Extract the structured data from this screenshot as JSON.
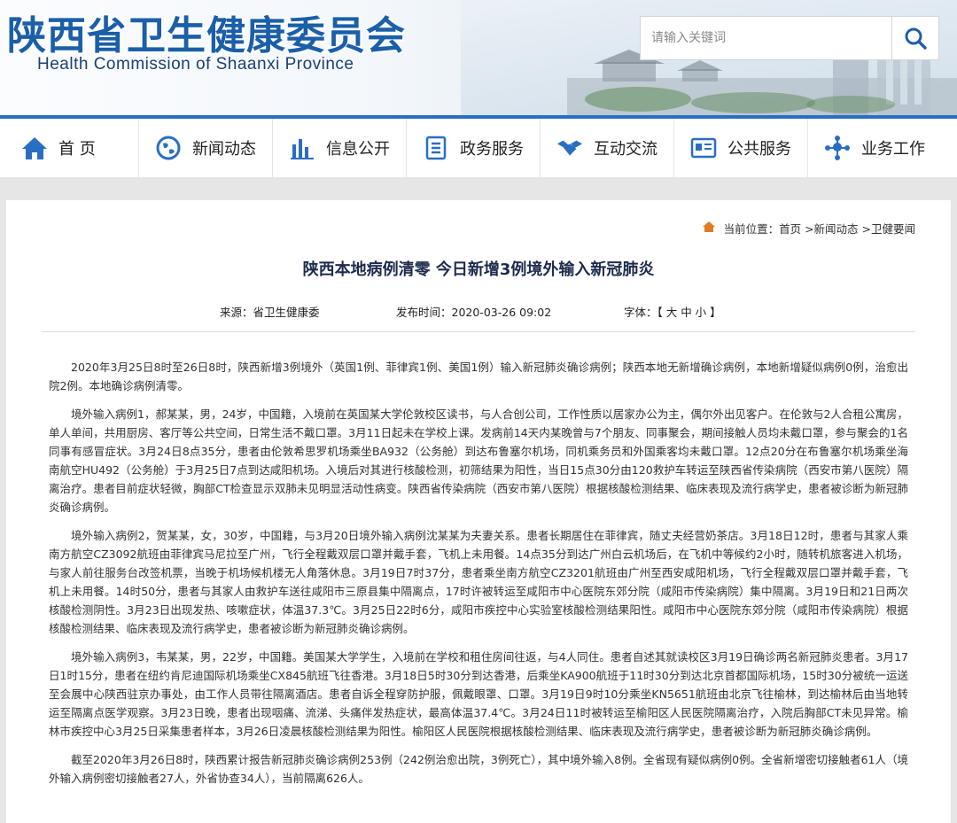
{
  "header": {
    "title": "陕西省卫生健康委员会",
    "subtitle": "Health Commission of Shaanxi Province",
    "search_placeholder": "请输入关键词"
  },
  "nav": {
    "items": [
      {
        "label": "首 页",
        "icon": "home-icon"
      },
      {
        "label": "新闻动态",
        "icon": "globe-icon"
      },
      {
        "label": "信息公开",
        "icon": "bar-chart-icon"
      },
      {
        "label": "政务服务",
        "icon": "document-icon"
      },
      {
        "label": "互动交流",
        "icon": "handshake-icon"
      },
      {
        "label": "公共服务",
        "icon": "id-card-icon"
      },
      {
        "label": "业务工作",
        "icon": "network-icon"
      }
    ]
  },
  "breadcrumb": {
    "prefix": "当前位置：",
    "path": "首页 >新闻动态 >卫健要闻"
  },
  "article": {
    "title": "陕西本地病例清零 今日新增3例境外输入新冠肺炎",
    "source": "来源：省卫生健康委",
    "publish_time": "发布时间：2020-03-26 09:02",
    "font_size": "字体：【 大 中 小 】",
    "paragraphs": [
      "2020年3月25日8时至26日8时，陕西新增3例境外（英国1例、菲律宾1例、美国1例）输入新冠肺炎确诊病例；陕西本地无新增确诊病例，本地新增疑似病例0例，治愈出院2例。本地确诊病例清零。",
      "境外输入病例1，郝某某，男，24岁，中国籍，入境前在英国某大学伦敦校区读书，与人合创公司，工作性质以居家办公为主，偶尔外出见客户。在伦敦与2人合租公寓房，单人单间，共用厨房、客厅等公共空间，日常生活不戴口罩。3月11日起未在学校上课。发病前14天内某晚曾与7个朋友、同事聚会，期间接触人员均未戴口罩，参与聚会的1名同事有感冒症状。3月24日8点35分，患者由伦敦希思罗机场乘坐BA932（公务舱）到达布鲁塞尔机场，同机乘务员和外国乘客均未戴口罩。12点20分在布鲁塞尔机场乘坐海南航空HU492（公务舱）于3月25日7点到达咸阳机场。入境后对其进行核酸检测，初筛结果为阳性，当日15点30分由120救护车转运至陕西省传染病院（西安市第八医院）隔离治疗。患者目前症状轻微，胸部CT检查显示双肺未见明显活动性病变。陕西省传染病院（西安市第八医院）根据核酸检测结果、临床表现及流行病学史，患者被诊断为新冠肺炎确诊病例。",
      " 境外输入病例2，贺某某，女，30岁，中国籍，与3月20日境外输入病例沈某某为夫妻关系。患者长期居住在菲律宾，随丈夫经营奶茶店。3月18日12时，患者与其家人乘南方航空CZ3092航班由菲律宾马尼拉至广州，飞行全程戴双层口罩并戴手套，飞机上未用餐。14点35分到达广州白云机场后，在飞机中等候约2小时，随转机旅客进入机场，与家人前往服务台改签机票，当晚于机场候机楼无人角落休息。3月19日7时37分，患者乘坐南方航空CZ3201航班由广州至西安咸阳机场，飞行全程戴双层口罩并戴手套，飞机上未用餐。14时50分，患者与其家人由救护车送往咸阳市三原县集中隔离点，17时许被转运至咸阳市中心医院东郊分院（咸阳市传染病院）集中隔离。3月19日和21日两次核酸检测阴性。3月23日出现发热、咳嗽症状，体温37.3℃。3月25日22时6分，咸阳市疾控中心实验室核酸检测结果阳性。咸阳市中心医院东郊分院（咸阳市传染病院）根据核酸检测结果、临床表现及流行病学史，患者被诊断为新冠肺炎确诊病例。",
      "境外输入病例3，韦某某，男，22岁，中国籍。美国某大学学生，入境前在学校和租住房间往返，与4人同住。患者自述其就读校区3月19日确诊两名新冠肺炎患者。3月17日1时15分，患者在纽约肯尼迪国际机场乘坐CX845航班飞往香港。3月18日5时30分到达香港，后乘坐KA900航班于11时30分到达北京首都国际机场，15时30分被统一运送至会展中心陕西驻京办事处，由工作人员带往隔离酒店。患者自诉全程穿防护服，佩戴眼罩、口罩。3月19日9时10分乘坐KN5651航班由北京飞往榆林，到达榆林后由当地转运至隔离点医学观察。3月23日晚，患者出现咽痛、流涕、头痛伴发热症状，最高体温37.4℃。3月24日11时被转运至榆阳区人民医院隔离治疗，入院后胸部CT未见异常。榆林市疾控中心3月25日采集患者样本，3月26日凌晨核酸检测结果为阳性。榆阳区人民医院根据核酸检测结果、临床表现及流行病学史，患者被诊断为新冠肺炎确诊病例。",
      "截至2020年3月26日8时，陕西累计报告新冠肺炎确诊病例253例（242例治愈出院，3例死亡），其中境外输入8例。全省现有疑似病例0例。全省新增密切接触者61人（境外输入病例密切接触者27人，外省协查34人），当前隔离626人。"
    ]
  },
  "colors": {
    "brand_blue": "#1a5fa8",
    "nav_icon_blue": "#2a6ec2",
    "title_navy": "#1d2b4d"
  }
}
